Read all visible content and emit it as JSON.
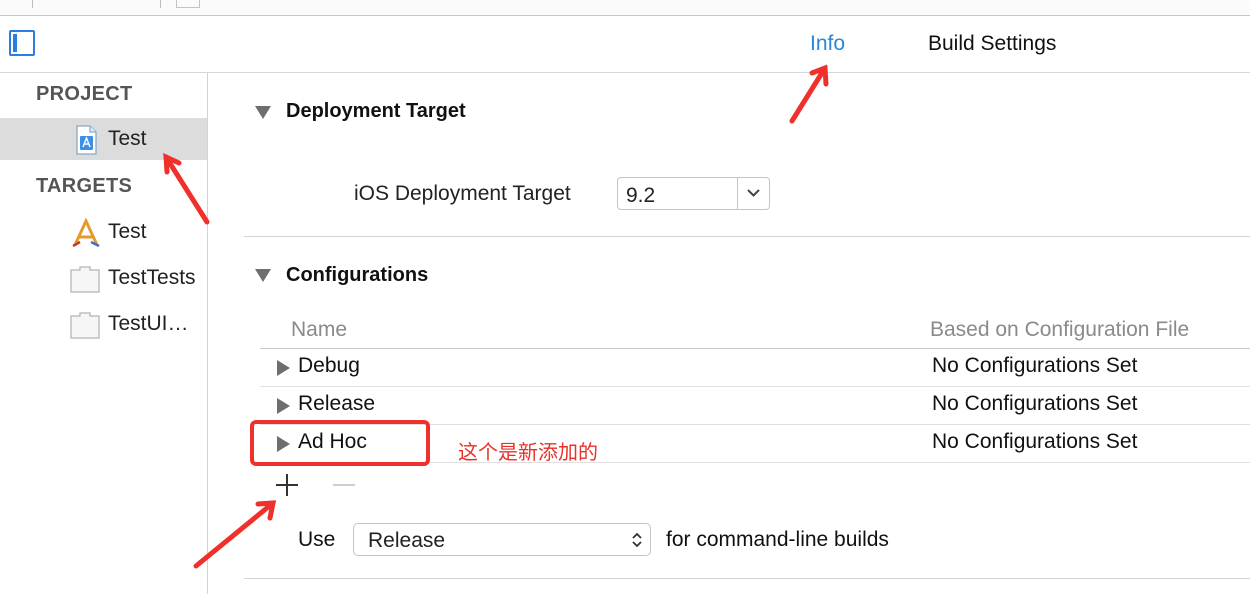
{
  "header": {
    "tabs": [
      {
        "label": "Info",
        "active": true
      },
      {
        "label": "Build Settings",
        "active": false
      }
    ]
  },
  "sidebar": {
    "project_header": "PROJECT",
    "project_item": "Test",
    "targets_header": "TARGETS",
    "targets": [
      "Test",
      "TestTests",
      "TestUI…"
    ]
  },
  "deployment": {
    "title": "Deployment Target",
    "label": "iOS Deployment Target",
    "value": "9.2"
  },
  "configurations": {
    "title": "Configurations",
    "columns": [
      "Name",
      "Based on Configuration File"
    ],
    "rows": [
      {
        "name": "Debug",
        "based_on": "No Configurations Set"
      },
      {
        "name": "Release",
        "based_on": "No Configurations Set"
      },
      {
        "name": "Ad Hoc",
        "based_on": "No Configurations Set"
      }
    ],
    "use_label": "Use",
    "use_value": "Release",
    "use_suffix": "for command-line builds"
  },
  "annotation": {
    "text": "这个是新添加的",
    "color": "#e8312a"
  },
  "colors": {
    "accent": "#2a86d8",
    "annotation_red": "#f0302a"
  }
}
